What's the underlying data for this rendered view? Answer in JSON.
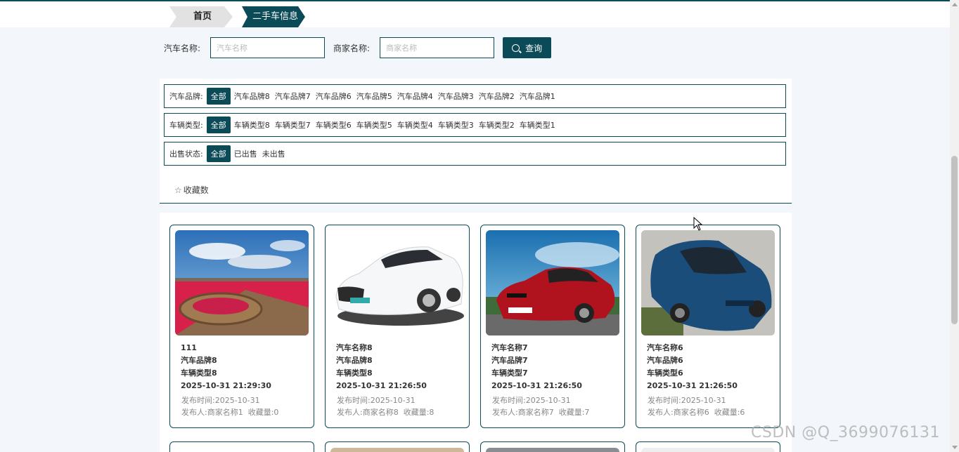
{
  "breadcrumb": {
    "home": "首页",
    "current": "二手车信息"
  },
  "search": {
    "car_name_label": "汽车名称:",
    "car_name_placeholder": "汽车名称",
    "merchant_label": "商家名称:",
    "merchant_placeholder": "商家名称",
    "button": "查询"
  },
  "filters": [
    {
      "label": "汽车品牌:",
      "options": [
        "全部",
        "汽车品牌8",
        "汽车品牌7",
        "汽车品牌6",
        "汽车品牌5",
        "汽车品牌4",
        "汽车品牌3",
        "汽车品牌2",
        "汽车品牌1"
      ],
      "active": 0
    },
    {
      "label": "车辆类型:",
      "options": [
        "全部",
        "车辆类型8",
        "车辆类型7",
        "车辆类型6",
        "车辆类型5",
        "车辆类型4",
        "车辆类型3",
        "车辆类型2",
        "车辆类型1"
      ],
      "active": 0
    },
    {
      "label": "出售状态:",
      "options": [
        "全部",
        "已出售",
        "未出售"
      ],
      "active": 0
    }
  ],
  "sort": {
    "favorites": "收藏数"
  },
  "cards": [
    {
      "name": "111",
      "brand": "汽车品牌8",
      "type": "车辆类型8",
      "datetime": "2025-10-31 21:29:30",
      "publish_time": "发布时间:2025-10-31",
      "publisher": "发布人:商家名称1",
      "favorites": "收藏量:0",
      "image": "landscape"
    },
    {
      "name": "汽车名称8",
      "brand": "汽车品牌8",
      "type": "车辆类型8",
      "datetime": "2025-10-31 21:26:50",
      "publish_time": "发布时间:2025-10-31",
      "publisher": "发布人:商家名称8",
      "favorites": "收藏量:8",
      "image": "white-sedan"
    },
    {
      "name": "汽车名称7",
      "brand": "汽车品牌7",
      "type": "车辆类型7",
      "datetime": "2025-10-31 21:26:50",
      "publish_time": "发布时间:2025-10-31",
      "publisher": "发布人:商家名称7",
      "favorites": "收藏量:7",
      "image": "red-coupe"
    },
    {
      "name": "汽车名称6",
      "brand": "汽车品牌6",
      "type": "车辆类型6",
      "datetime": "2025-10-31 21:26:50",
      "publish_time": "发布时间:2025-10-31",
      "publisher": "发布人:商家名称6",
      "favorites": "收藏量:6",
      "image": "blue-sedan"
    }
  ],
  "watermark": "CSDN @Q_3699076131",
  "colors": {
    "primary": "#0b4a57",
    "background": "#f3f6fb"
  }
}
